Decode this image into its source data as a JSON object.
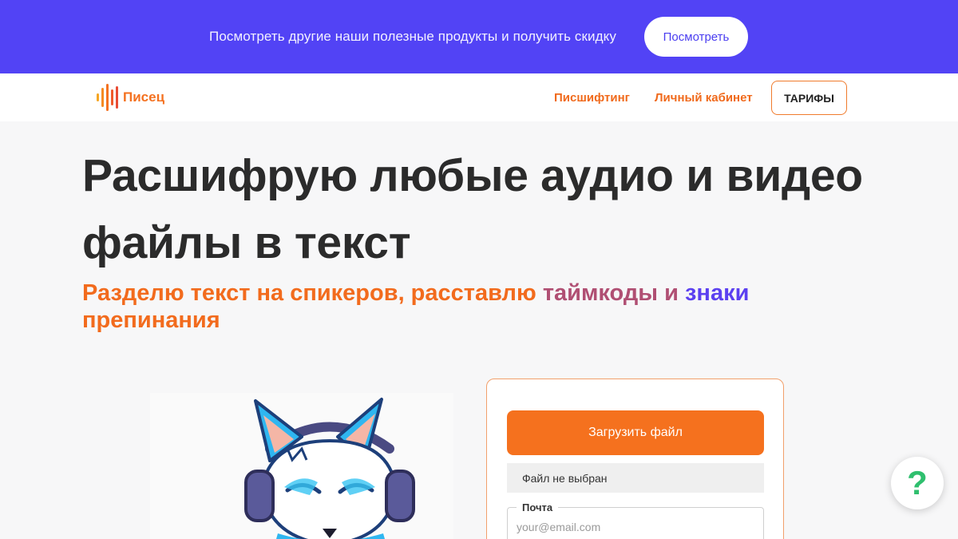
{
  "promo": {
    "text": "Посмотреть другие наши полезные продукты и получить скидку",
    "button_label": "Посмотреть"
  },
  "nav": {
    "logo_text": "Писец",
    "links": [
      "Писшифтинг",
      "Личный кабинет"
    ],
    "cta_label": "ТАРИФЫ"
  },
  "hero": {
    "title_line1": "Расшифрую любые аудио и видео",
    "title_line2": "файлы в текст",
    "subtitle_part1": "Разделю текст на спикеров, расставлю ",
    "subtitle_part2": "таймкоды",
    "subtitle_part3": " и ",
    "subtitle_part4": "знаки",
    "subtitle_part5": "препинания"
  },
  "upload": {
    "button_label": "Загрузить файл",
    "file_status": "Файл не выбран",
    "email_label": "Почта",
    "email_placeholder": "your@email.com",
    "email_value": ""
  },
  "help_icon": "?",
  "colors": {
    "promo_bg": "#5243f5",
    "accent_orange": "#f5711e",
    "accent_violet": "#5b40f0",
    "help_green": "#2fbf6e"
  },
  "icons": {
    "logo": "sound-wave-logo-icon",
    "help": "question-mark-icon",
    "mascot": "fox-with-headphones-illustration"
  }
}
